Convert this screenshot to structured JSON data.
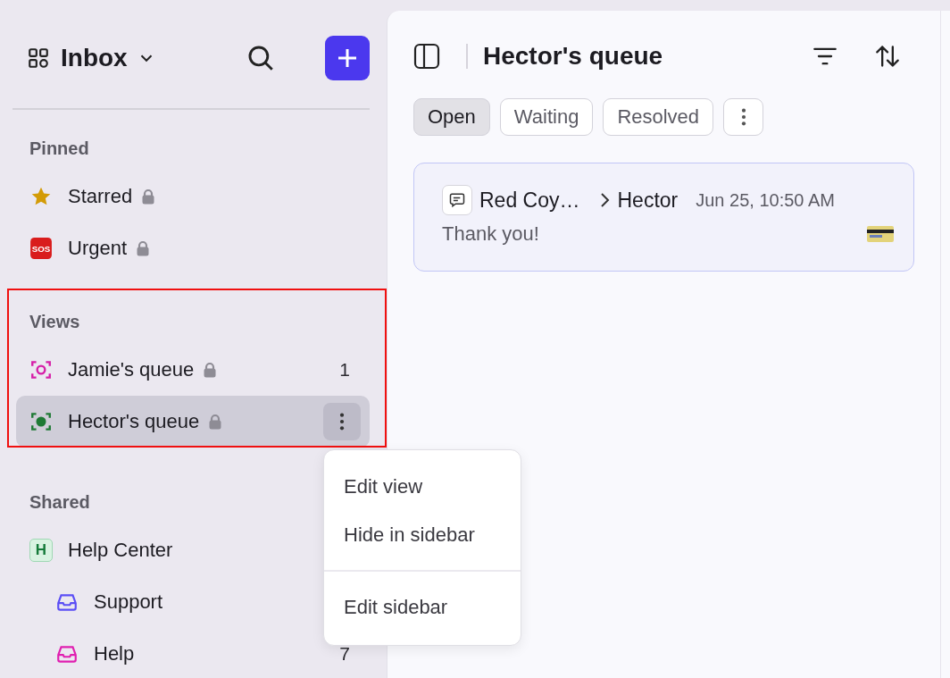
{
  "sidebar": {
    "title": "Inbox",
    "sections": [
      {
        "label": "Pinned",
        "items": [
          {
            "label": "Starred",
            "kind": "star",
            "locked": true,
            "selected": false
          },
          {
            "label": "Urgent",
            "kind": "sos",
            "icon_text": "SOS",
            "locked": true,
            "selected": false
          }
        ]
      },
      {
        "label": "Views",
        "highlighted": true,
        "items": [
          {
            "label": "Jamie's queue",
            "kind": "view",
            "color": "#d61fa8",
            "locked": true,
            "count": "1",
            "selected": false
          },
          {
            "label": "Hector's queue",
            "kind": "view",
            "color": "#1f7a35",
            "locked": true,
            "selected": true
          }
        ]
      },
      {
        "label": "Shared",
        "items": [
          {
            "label": "Help Center",
            "kind": "badge",
            "icon_text": "H",
            "selected": false,
            "children": [
              {
                "label": "Support",
                "kind": "inbox",
                "color": "#5b4ef5",
                "selected": false
              },
              {
                "label": "Help",
                "kind": "inbox",
                "color": "#e01fb0",
                "count": "7",
                "selected": false
              }
            ]
          }
        ]
      }
    ]
  },
  "main": {
    "title": "Hector's queue",
    "tabs": [
      {
        "label": "Open",
        "selected": true
      },
      {
        "label": "Waiting",
        "selected": false
      },
      {
        "label": "Resolved",
        "selected": false
      }
    ],
    "conversations": [
      {
        "from": "Red Coy…",
        "to": "Hector",
        "time": "Jun 25, 10:50 AM",
        "preview": "Thank you!"
      }
    ]
  },
  "menu": {
    "groups": [
      [
        "Edit view",
        "Hide in sidebar"
      ],
      [
        "Edit sidebar"
      ]
    ]
  }
}
